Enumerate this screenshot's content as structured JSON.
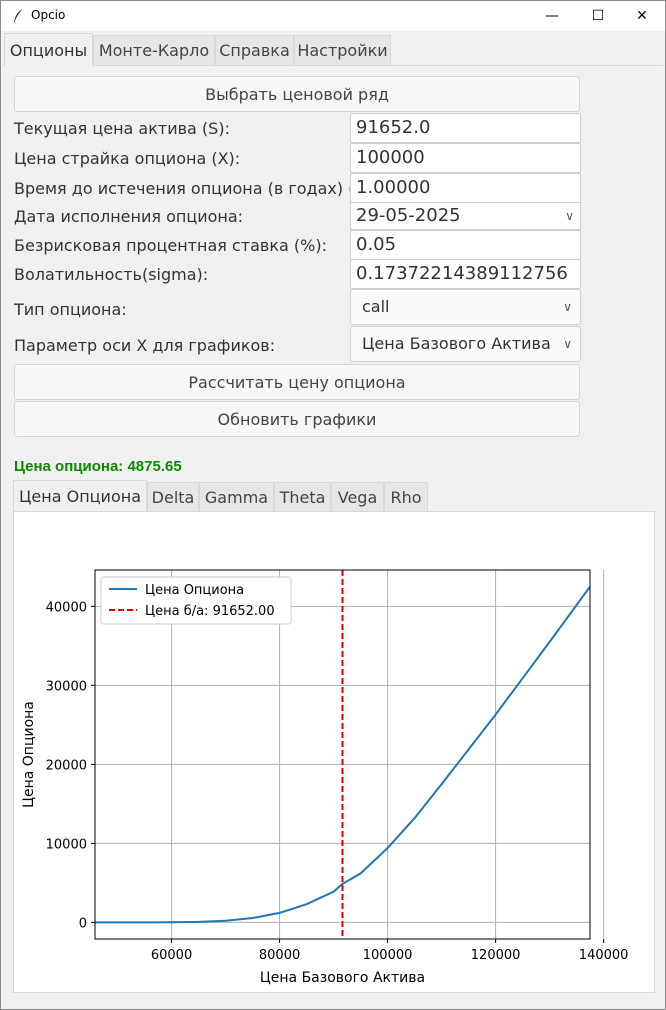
{
  "window": {
    "title": "Opcio",
    "minimize": "—",
    "maximize": "☐",
    "close": "✕"
  },
  "main_tabs": [
    {
      "label": "Опционы"
    },
    {
      "label": "Монте-Карло"
    },
    {
      "label": "Справка"
    },
    {
      "label": "Настройки"
    }
  ],
  "form": {
    "select_series_button": "Выбрать ценовой ряд",
    "asset_price_label": "Текущая цена актива (S):",
    "asset_price_value": "91652.0",
    "strike_label": "Цена страйка опциона (X):",
    "strike_value": "100000",
    "time_label": "Время до истечения опциона (в годах) (T):",
    "time_value": "1.00000",
    "expiry_label": "Дата исполнения опциона:",
    "expiry_value": "29-05-2025",
    "rate_label": "Безрисковая процентная ставка (%):",
    "rate_value": "0.05",
    "vol_label": "Волатильность(sigma):",
    "vol_value": "0.17372214389112756",
    "type_label": "Тип опциона:",
    "type_value": "call",
    "xaxis_label": "Параметр оси X для графиков:",
    "xaxis_value": "Цена Базового Актива",
    "calc_button": "Рассчитать цену опциона",
    "update_button": "Обновить графики"
  },
  "result_text": "Цена опциона: 4875.65",
  "plot_tabs": [
    {
      "label": "Цена Опциона"
    },
    {
      "label": "Delta"
    },
    {
      "label": "Gamma"
    },
    {
      "label": "Theta"
    },
    {
      "label": "Vega"
    },
    {
      "label": "Rho"
    }
  ],
  "colors": {
    "line": "#1f77b4",
    "marker": "#e00000",
    "result": "#0a8a00"
  },
  "chart_data": {
    "type": "line",
    "xlabel": "Цена Базового Актива",
    "ylabel": "Цена Опциона",
    "xlim": [
      45826,
      137478
    ],
    "ylim": [
      -2100,
      44600
    ],
    "xticks": [
      60000,
      80000,
      100000,
      120000,
      140000
    ],
    "xtick_labels": [
      "60000",
      "80000",
      "100000",
      "120000",
      "140000"
    ],
    "yticks": [
      0,
      10000,
      20000,
      30000,
      40000
    ],
    "ytick_labels": [
      "0",
      "10000",
      "20000",
      "30000",
      "40000"
    ],
    "grid": true,
    "legend_position": "upper left",
    "series": [
      {
        "name": "Цена Опциона",
        "x": [
          45826,
          50000,
          55000,
          60000,
          65000,
          70000,
          75000,
          80000,
          85000,
          90000,
          91652,
          95000,
          100000,
          105000,
          110000,
          115000,
          120000,
          125000,
          130000,
          137478
        ],
        "values": [
          0,
          0,
          2,
          15,
          70,
          220,
          560,
          1200,
          2300,
          3900,
          4876,
          6200,
          9400,
          13200,
          17500,
          21900,
          26300,
          30900,
          35500,
          42500
        ]
      }
    ],
    "vline": {
      "name": "Цена б/а: 91652.00",
      "x": 91652
    }
  }
}
